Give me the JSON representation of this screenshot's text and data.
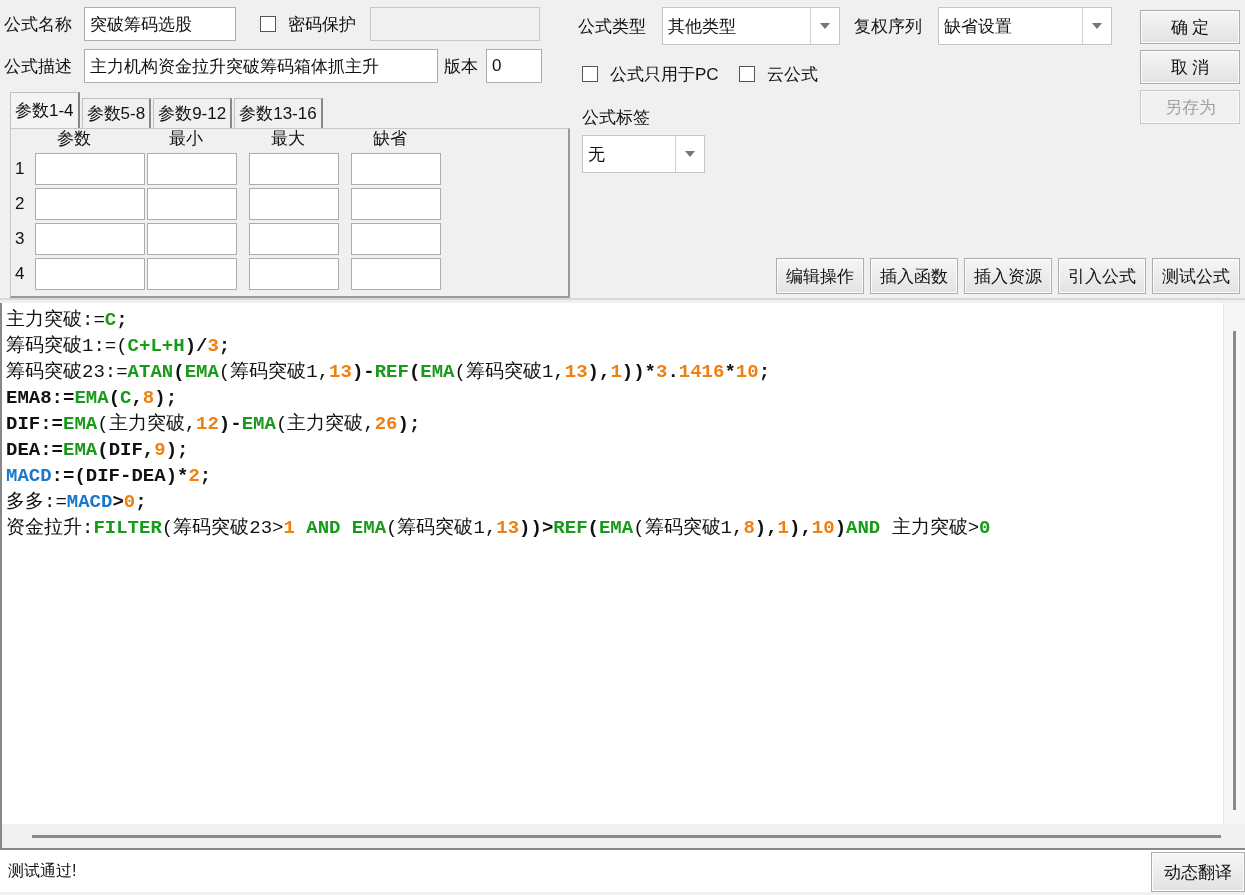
{
  "formula_name": {
    "label": "公式名称",
    "value": "突破筹码选股"
  },
  "password": {
    "label": "密码保护",
    "checked": false
  },
  "description": {
    "label": "公式描述",
    "value": "主力机构资金拉升突破筹码箱体抓主升"
  },
  "version": {
    "label": "版本",
    "value": "0"
  },
  "param_tabs": [
    {
      "label": "参数1-4",
      "selected": true
    },
    {
      "label": "参数5-8",
      "selected": false
    },
    {
      "label": "参数9-12",
      "selected": false
    },
    {
      "label": "参数13-16",
      "selected": false
    }
  ],
  "param_columns": [
    "参数",
    "最小",
    "最大",
    "缺省"
  ],
  "param_rows": [
    "1",
    "2",
    "3",
    "4"
  ],
  "formula_type": {
    "label": "公式类型",
    "value": "其他类型"
  },
  "rights_order": {
    "label": "复权序列",
    "value": "缺省设置"
  },
  "options": [
    {
      "label": "公式只用于PC",
      "checked": false
    },
    {
      "label": "云公式",
      "checked": false
    }
  ],
  "tag": {
    "label": "公式标签",
    "value": "无"
  },
  "dialog_buttons": [
    {
      "label": "确 定",
      "disabled": false
    },
    {
      "label": "取 消",
      "disabled": false
    },
    {
      "label": "另存为",
      "disabled": true
    }
  ],
  "tool_buttons": [
    "编辑操作",
    "插入函数",
    "插入资源",
    "引入公式",
    "测试公式"
  ],
  "code_lines": [
    [
      {
        "t": "主力突破:=",
        "kind": "plain"
      },
      {
        "t": "C",
        "kind": "func"
      },
      {
        "t": ";",
        "kind": "plain"
      }
    ],
    [
      {
        "t": "筹码突破1:=(",
        "kind": "plain"
      },
      {
        "t": "C+L+H",
        "kind": "func"
      },
      {
        "t": ")/",
        "kind": "plain"
      },
      {
        "t": "3",
        "kind": "num"
      },
      {
        "t": ";",
        "kind": "plain"
      }
    ],
    [
      {
        "t": "筹码突破23:=",
        "kind": "plain"
      },
      {
        "t": "ATAN",
        "kind": "func"
      },
      {
        "t": "(",
        "kind": "plain"
      },
      {
        "t": "EMA",
        "kind": "func"
      },
      {
        "t": "(筹码突破1,",
        "kind": "plain"
      },
      {
        "t": "13",
        "kind": "num"
      },
      {
        "t": ")-",
        "kind": "plain"
      },
      {
        "t": "REF",
        "kind": "func"
      },
      {
        "t": "(",
        "kind": "plain"
      },
      {
        "t": "EMA",
        "kind": "func"
      },
      {
        "t": "(筹码突破1,",
        "kind": "plain"
      },
      {
        "t": "13",
        "kind": "num"
      },
      {
        "t": "),",
        "kind": "plain"
      },
      {
        "t": "1",
        "kind": "num"
      },
      {
        "t": "))*",
        "kind": "plain"
      },
      {
        "t": "3",
        "kind": "num"
      },
      {
        "t": ".",
        "kind": "plain"
      },
      {
        "t": "1416",
        "kind": "num"
      },
      {
        "t": "*",
        "kind": "plain"
      },
      {
        "t": "10",
        "kind": "num"
      },
      {
        "t": ";",
        "kind": "plain"
      }
    ],
    [
      {
        "t": "EMA8:=",
        "kind": "plain"
      },
      {
        "t": "EMA",
        "kind": "func"
      },
      {
        "t": "(",
        "kind": "plain"
      },
      {
        "t": "C",
        "kind": "func"
      },
      {
        "t": ",",
        "kind": "plain"
      },
      {
        "t": "8",
        "kind": "num"
      },
      {
        "t": ");",
        "kind": "plain"
      }
    ],
    [
      {
        "t": "DIF:=",
        "kind": "plain"
      },
      {
        "t": "EMA",
        "kind": "func"
      },
      {
        "t": "(主力突破,",
        "kind": "plain"
      },
      {
        "t": "12",
        "kind": "num"
      },
      {
        "t": ")-",
        "kind": "plain"
      },
      {
        "t": "EMA",
        "kind": "func"
      },
      {
        "t": "(主力突破,",
        "kind": "plain"
      },
      {
        "t": "26",
        "kind": "num"
      },
      {
        "t": ");",
        "kind": "plain"
      }
    ],
    [
      {
        "t": "DEA:=",
        "kind": "plain"
      },
      {
        "t": "EMA",
        "kind": "func"
      },
      {
        "t": "(DIF,",
        "kind": "plain"
      },
      {
        "t": "9",
        "kind": "num"
      },
      {
        "t": ");",
        "kind": "plain"
      }
    ],
    [
      {
        "t": "MACD",
        "kind": "var"
      },
      {
        "t": ":=(DIF-DEA)*",
        "kind": "plain"
      },
      {
        "t": "2",
        "kind": "num"
      },
      {
        "t": ";",
        "kind": "plain"
      }
    ],
    [
      {
        "t": "多多:=",
        "kind": "plain"
      },
      {
        "t": "MACD",
        "kind": "var"
      },
      {
        "t": ">",
        "kind": "plain"
      },
      {
        "t": "0",
        "kind": "num"
      },
      {
        "t": ";",
        "kind": "plain"
      }
    ],
    [
      {
        "t": "资金拉升:",
        "kind": "plain"
      },
      {
        "t": "FILTER",
        "kind": "func"
      },
      {
        "t": "(筹码突破23>",
        "kind": "plain"
      },
      {
        "t": "1",
        "kind": "num"
      },
      {
        "t": " AND ",
        "kind": "func"
      },
      {
        "t": "EMA",
        "kind": "func"
      },
      {
        "t": "(筹码突破1,",
        "kind": "plain"
      },
      {
        "t": "13",
        "kind": "num"
      },
      {
        "t": "))>",
        "kind": "plain"
      },
      {
        "t": "REF",
        "kind": "func"
      },
      {
        "t": "(",
        "kind": "plain"
      },
      {
        "t": "EMA",
        "kind": "func"
      },
      {
        "t": "(筹码突破1,",
        "kind": "plain"
      },
      {
        "t": "8",
        "kind": "num"
      },
      {
        "t": "),",
        "kind": "plain"
      },
      {
        "t": "1",
        "kind": "num"
      },
      {
        "t": "),",
        "kind": "plain"
      },
      {
        "t": "10",
        "kind": "num"
      },
      {
        "t": ")",
        "kind": "plain"
      },
      {
        "t": "AND",
        "kind": "func"
      },
      {
        "t": " 主力突破>",
        "kind": "plain"
      },
      {
        "t": "0",
        "kind": "func"
      }
    ]
  ],
  "status": {
    "message": "测试通过!"
  },
  "translate_button": "动态翻译"
}
